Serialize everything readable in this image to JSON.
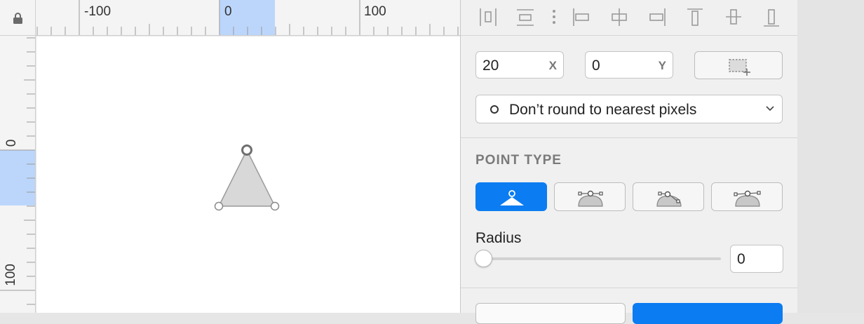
{
  "rulers": {
    "horizontal": {
      "labels": [
        "-100",
        "0",
        "100"
      ]
    },
    "vertical": {
      "labels": [
        "0",
        "100"
      ]
    }
  },
  "inspector": {
    "position": {
      "x_value": "20",
      "x_suffix": "X",
      "y_value": "0",
      "y_suffix": "Y"
    },
    "rounding": {
      "selected": "Don’t round to nearest pixels"
    },
    "point_type": {
      "title": "POINT TYPE",
      "options": [
        "straight",
        "mirrored",
        "disconnected",
        "asymmetric"
      ],
      "selected": "straight"
    },
    "radius": {
      "label": "Radius",
      "value": "0",
      "slider_level": 0
    }
  },
  "colors": {
    "accent": "#0b7cf2",
    "selection": "#bcd6fb"
  }
}
